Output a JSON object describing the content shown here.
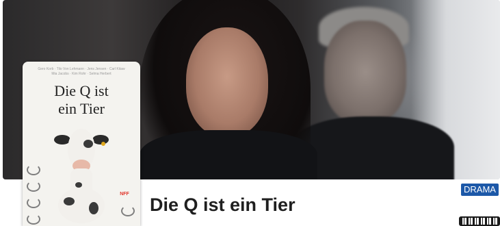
{
  "hero": {
    "image_alt": "Film still: woman and man in police uniforms"
  },
  "poster": {
    "credits_lines": [
      "Gero Korb · Tilo Von Lehmann · Jens Jensen · Carl Kitaw",
      "Mia Jacobs · Kim Rohr · Selma Herbert"
    ],
    "title_line1": "Die Q ist",
    "title_line2": "ein Tier",
    "badge_text": "NFF"
  },
  "movie": {
    "title": "Die Q ist ein Tier",
    "genre": "DRAMA"
  },
  "colors": {
    "genre_badge_bg": "#1c58a8",
    "title_text": "#1f1f1f"
  },
  "icons": {
    "qr": "qr-code-icon"
  }
}
